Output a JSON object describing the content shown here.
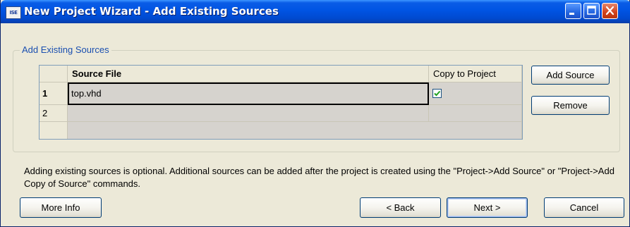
{
  "window": {
    "title": "New Project Wizard - Add Existing Sources",
    "app_icon_text": "ISE"
  },
  "group": {
    "label": "Add Existing Sources"
  },
  "grid": {
    "columns": [
      "Source File",
      "Copy to Project"
    ],
    "rows": [
      {
        "num": "1",
        "source_file": "top.vhd",
        "copy_to_project": true
      },
      {
        "num": "2",
        "source_file": "",
        "copy_to_project": null
      }
    ]
  },
  "side_buttons": {
    "add_source": "Add Source",
    "remove": "Remove"
  },
  "info_text": "Adding existing sources is optional. Additional sources can be added after the project is created using the \"Project->Add Source\" or \"Project->Add Copy of Source\" commands.",
  "footer_buttons": {
    "more_info": "More Info",
    "back": "< Back",
    "next": "Next >",
    "cancel": "Cancel"
  }
}
